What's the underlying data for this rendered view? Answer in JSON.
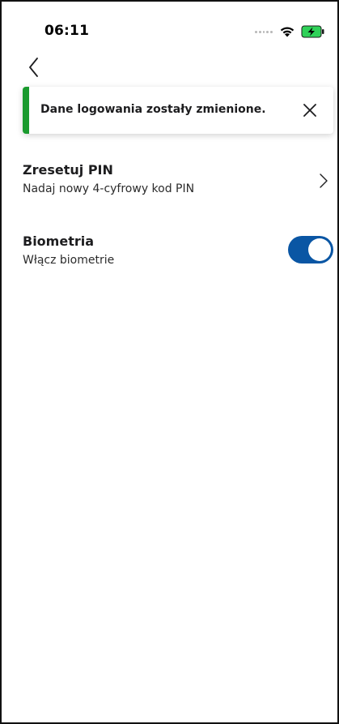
{
  "status_bar": {
    "time": "06:11",
    "wifi_icon": "wifi-icon",
    "battery_icon": "battery-charging-icon",
    "battery_color": "#2fd158"
  },
  "navigation": {
    "back_icon": "chevron-left-icon"
  },
  "toast": {
    "message": "Dane logowania zostały zmienione.",
    "accent_color": "#1a9a2e",
    "close_icon": "close-icon"
  },
  "settings": {
    "reset_pin": {
      "title": "Zresetuj PIN",
      "subtitle": "Nadaj nowy 4-cyfrowy kod PIN",
      "icon": "chevron-right-icon"
    },
    "biometrics": {
      "title": "Biometria",
      "subtitle": "Włącz biometrie",
      "enabled": true,
      "toggle_color": "#0a56a4"
    }
  }
}
